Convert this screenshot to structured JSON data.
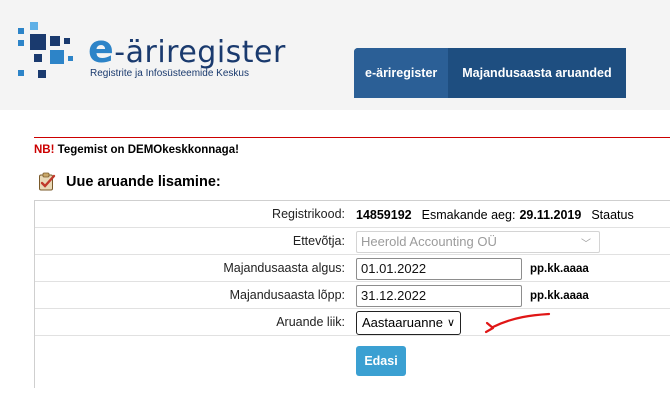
{
  "logo": {
    "title_e": "e",
    "title_rest": "-äriregister",
    "subtitle": "Registrite ja Infosüsteemide Keskus"
  },
  "nav": {
    "items": [
      {
        "label": "e-äriregister"
      },
      {
        "label": "Majandusaasta aruanded"
      }
    ]
  },
  "notice": {
    "nb": "NB!",
    "text": " Tegemist on DEMOkeskkonnaga!"
  },
  "section": {
    "title": "Uue aruande lisamine:",
    "icon": "clipboard-check-icon"
  },
  "form": {
    "registrikood_label": "Registrikood:",
    "registrikood_value": "14859192",
    "esmakande_label": "Esmakande aeg:",
    "esmakande_value": "29.11.2019",
    "staatus_label": "Staatus",
    "ettevotja_label": "Ettevõtja:",
    "ettevotja_value": "Heerold Accounting OÜ",
    "algus_label": "Majandusaasta algus:",
    "algus_value": "01.01.2022",
    "algus_hint": "pp.kk.aaaa",
    "lopp_label": "Majandusaasta lõpp:",
    "lopp_value": "31.12.2022",
    "lopp_hint": "pp.kk.aaaa",
    "liik_label": "Aruande liik:",
    "liik_value": "Aastaaruanne",
    "submit_label": "Edasi"
  },
  "colors": {
    "brand_dark": "#1e4e80",
    "brand_light": "#2b5f96",
    "button": "#3ba0d2",
    "notice_red": "#cc0000",
    "annotation_arrow": "#e01616"
  }
}
